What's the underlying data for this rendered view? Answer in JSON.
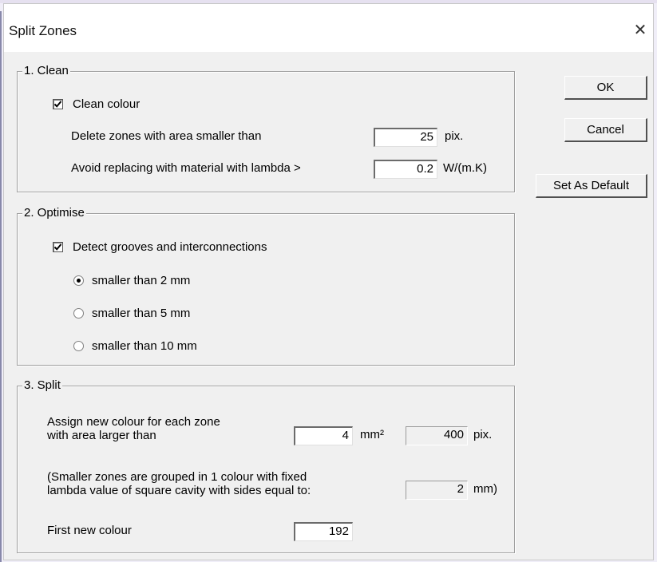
{
  "window": {
    "title": "Split Zones"
  },
  "buttons": {
    "ok": "OK",
    "cancel": "Cancel",
    "set_default": "Set As Default"
  },
  "clean": {
    "legend": "1. Clean",
    "clean_colour_label": "Clean colour",
    "clean_colour_checked": true,
    "delete_label": "Delete zones with area smaller than",
    "delete_value": "25",
    "delete_unit": "pix.",
    "avoid_label": "Avoid replacing with material with lambda >",
    "avoid_value": "0.2",
    "avoid_unit": "W/(m.K)"
  },
  "optimise": {
    "legend": "2. Optimise",
    "detect_label": "Detect grooves and interconnections",
    "detect_checked": true,
    "options": [
      {
        "label": "smaller than 2 mm",
        "selected": true
      },
      {
        "label": "smaller than 5 mm",
        "selected": false
      },
      {
        "label": "smaller than 10 mm",
        "selected": false
      }
    ]
  },
  "split": {
    "legend": "3. Split",
    "assign_label_line1": "Assign new colour for each zone",
    "assign_label_line2": "with area larger than",
    "assign_value": "4",
    "assign_unit": "mm²",
    "assign_pix_value": "400",
    "assign_pix_unit": "pix.",
    "smaller_line1": "(Smaller zones are grouped in 1 colour with fixed",
    "smaller_line2": "lambda value of square cavity with sides equal to:",
    "cavity_value": "2",
    "cavity_unit": "mm)",
    "first_colour_label": "First new colour",
    "first_colour_value": "192"
  },
  "icons": {
    "close": "close-icon",
    "check": "check-icon"
  }
}
